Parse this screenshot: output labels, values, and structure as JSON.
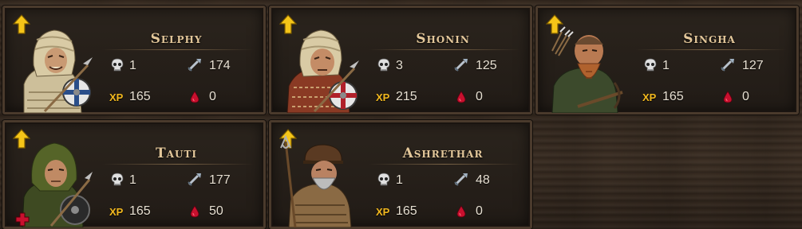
{
  "mercenaries": [
    {
      "name": "Selphy",
      "kills": "1",
      "blows": "174",
      "xp_label": "XP",
      "xp": "165",
      "blood": "0",
      "can_level_up": true,
      "wounded": false
    },
    {
      "name": "Shonin",
      "kills": "3",
      "blows": "125",
      "xp_label": "XP",
      "xp": "215",
      "blood": "0",
      "can_level_up": true,
      "wounded": false
    },
    {
      "name": "Singha",
      "kills": "1",
      "blows": "127",
      "xp_label": "XP",
      "xp": "165",
      "blood": "0",
      "can_level_up": true,
      "wounded": false
    },
    {
      "name": "Tauti",
      "kills": "1",
      "blows": "177",
      "xp_label": "XP",
      "xp": "165",
      "blood": "50",
      "can_level_up": true,
      "wounded": true
    },
    {
      "name": "Ashrethar",
      "kills": "1",
      "blows": "48",
      "xp_label": "XP",
      "xp": "165",
      "blood": "0",
      "can_level_up": true,
      "wounded": false
    }
  ],
  "icons": {
    "level_up": "arrow-up-icon",
    "kills": "skull-icon",
    "blows": "sword-icon",
    "blood": "blood-drop-icon",
    "wounded": "red-cross-icon"
  },
  "colors": {
    "name": "#e3c79a",
    "xp": "#f2b81e",
    "level_up": "#f5c518",
    "blood": "#c8102e",
    "wounded": "#c8102e"
  }
}
